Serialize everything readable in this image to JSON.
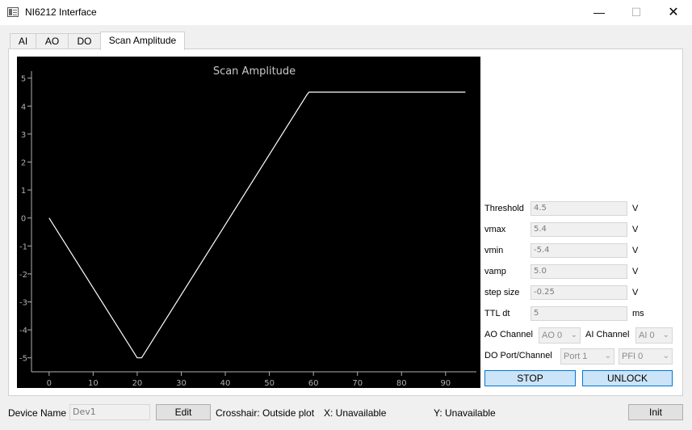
{
  "window": {
    "title": "NI6212 Interface",
    "minimize_glyph": "—",
    "maximize_glyph": "☐",
    "close_glyph": "✕"
  },
  "tabs": [
    {
      "label": "AI",
      "active": false
    },
    {
      "label": "AO",
      "active": false
    },
    {
      "label": "DO",
      "active": false
    },
    {
      "label": "Scan Amplitude",
      "active": true
    }
  ],
  "chart_data": {
    "type": "line",
    "title": "Scan Amplitude",
    "xlim": [
      -4,
      97
    ],
    "ylim": [
      -5.5,
      5.25
    ],
    "x_ticks": [
      "0",
      "10",
      "20",
      "30",
      "40",
      "50",
      "60",
      "70",
      "80",
      "90"
    ],
    "y_ticks": [
      "5",
      "4",
      "3",
      "2",
      "1",
      "0",
      "-1",
      "-2",
      "-3",
      "-4",
      "-5"
    ],
    "series": [
      {
        "x": [
          0,
          20,
          21,
          58.5,
          59,
          94.5
        ],
        "y": [
          0,
          -5,
          -5,
          4.4,
          4.5,
          4.5
        ],
        "color": "#ffffff"
      }
    ]
  },
  "params": [
    {
      "label": "Threshold",
      "value": "4.5",
      "unit": "V"
    },
    {
      "label": "vmax",
      "value": "5.4",
      "unit": "V"
    },
    {
      "label": "vmin",
      "value": "-5.4",
      "unit": "V"
    },
    {
      "label": "vamp",
      "value": "5.0",
      "unit": "V"
    },
    {
      "label": "step size",
      "value": "-0.25",
      "unit": "V"
    },
    {
      "label": "TTL dt",
      "value": "5",
      "unit": "ms"
    }
  ],
  "channels": {
    "ao_label": "AO Channel",
    "ao_value": "AO 0",
    "ai_label": "AI Channel",
    "ai_value": "AI 0",
    "do_label": "DO Port/Channel",
    "do_port": "Port 1",
    "do_channel": "PFI 0"
  },
  "buttons": {
    "stop": "STOP",
    "unlock": "UNLOCK",
    "edit": "Edit",
    "init": "Init"
  },
  "bottom": {
    "device_label": "Device Name",
    "device_value": "Dev1",
    "crosshair": "Crosshair: Outside plot",
    "x_readout": "X: Unavailable",
    "y_readout": "Y: Unavailable"
  },
  "colors": {
    "accent": "#0078d7",
    "button_blue": "#cce4f7",
    "plot_bg": "#000000",
    "axis": "#b0b0b0"
  }
}
